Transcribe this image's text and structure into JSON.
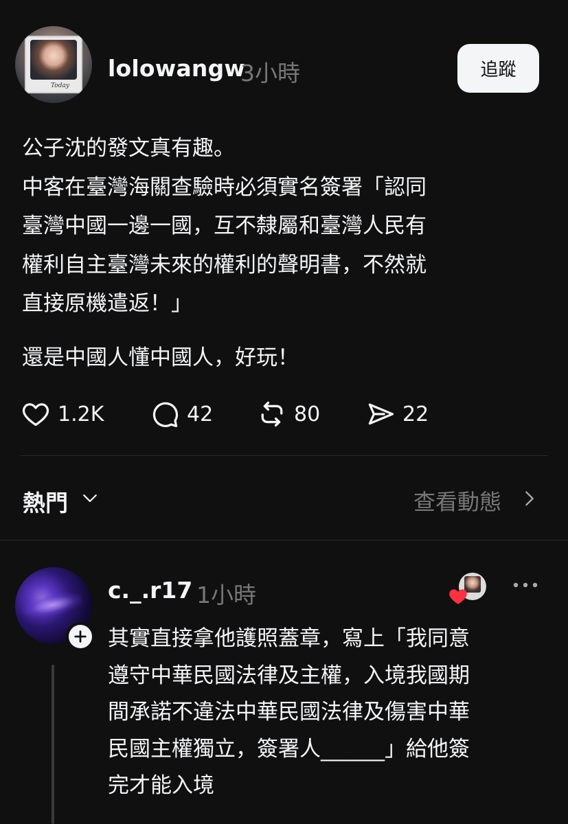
{
  "post": {
    "username": "lolowangw",
    "time": "3小時",
    "follow_label": "追蹤",
    "avatar_caption": "Today",
    "paragraphs": [
      "公子沈的發文真有趣。\n中客在臺灣海關查驗時必須實名簽署「認同\n臺灣中國一邊一國，互不隸屬和臺灣人民有\n權利自主臺灣未來的權利的聲明書，不然就\n直接原機遣返！」",
      "還是中國人懂中國人，好玩！"
    ],
    "stats": {
      "likes": "1.2K",
      "comments": "42",
      "reposts": "80",
      "shares": "22"
    }
  },
  "sort": {
    "label": "熱門",
    "activity_link": "查看動態"
  },
  "reply": {
    "username": "c._.r17",
    "time": "1小時",
    "text": "其實直接拿他護照蓋章，寫上「我同意\n遵守中華民國法律及主權，入境我國期\n間承諾不違法中華民國法律及傷害中華\n民國主權獨立，簽署人______」給他簽\n完才能入境"
  },
  "colors": {
    "background": "#101010",
    "text": "#f3f5f7",
    "muted": "#777777",
    "like_red": "#ff3040"
  }
}
